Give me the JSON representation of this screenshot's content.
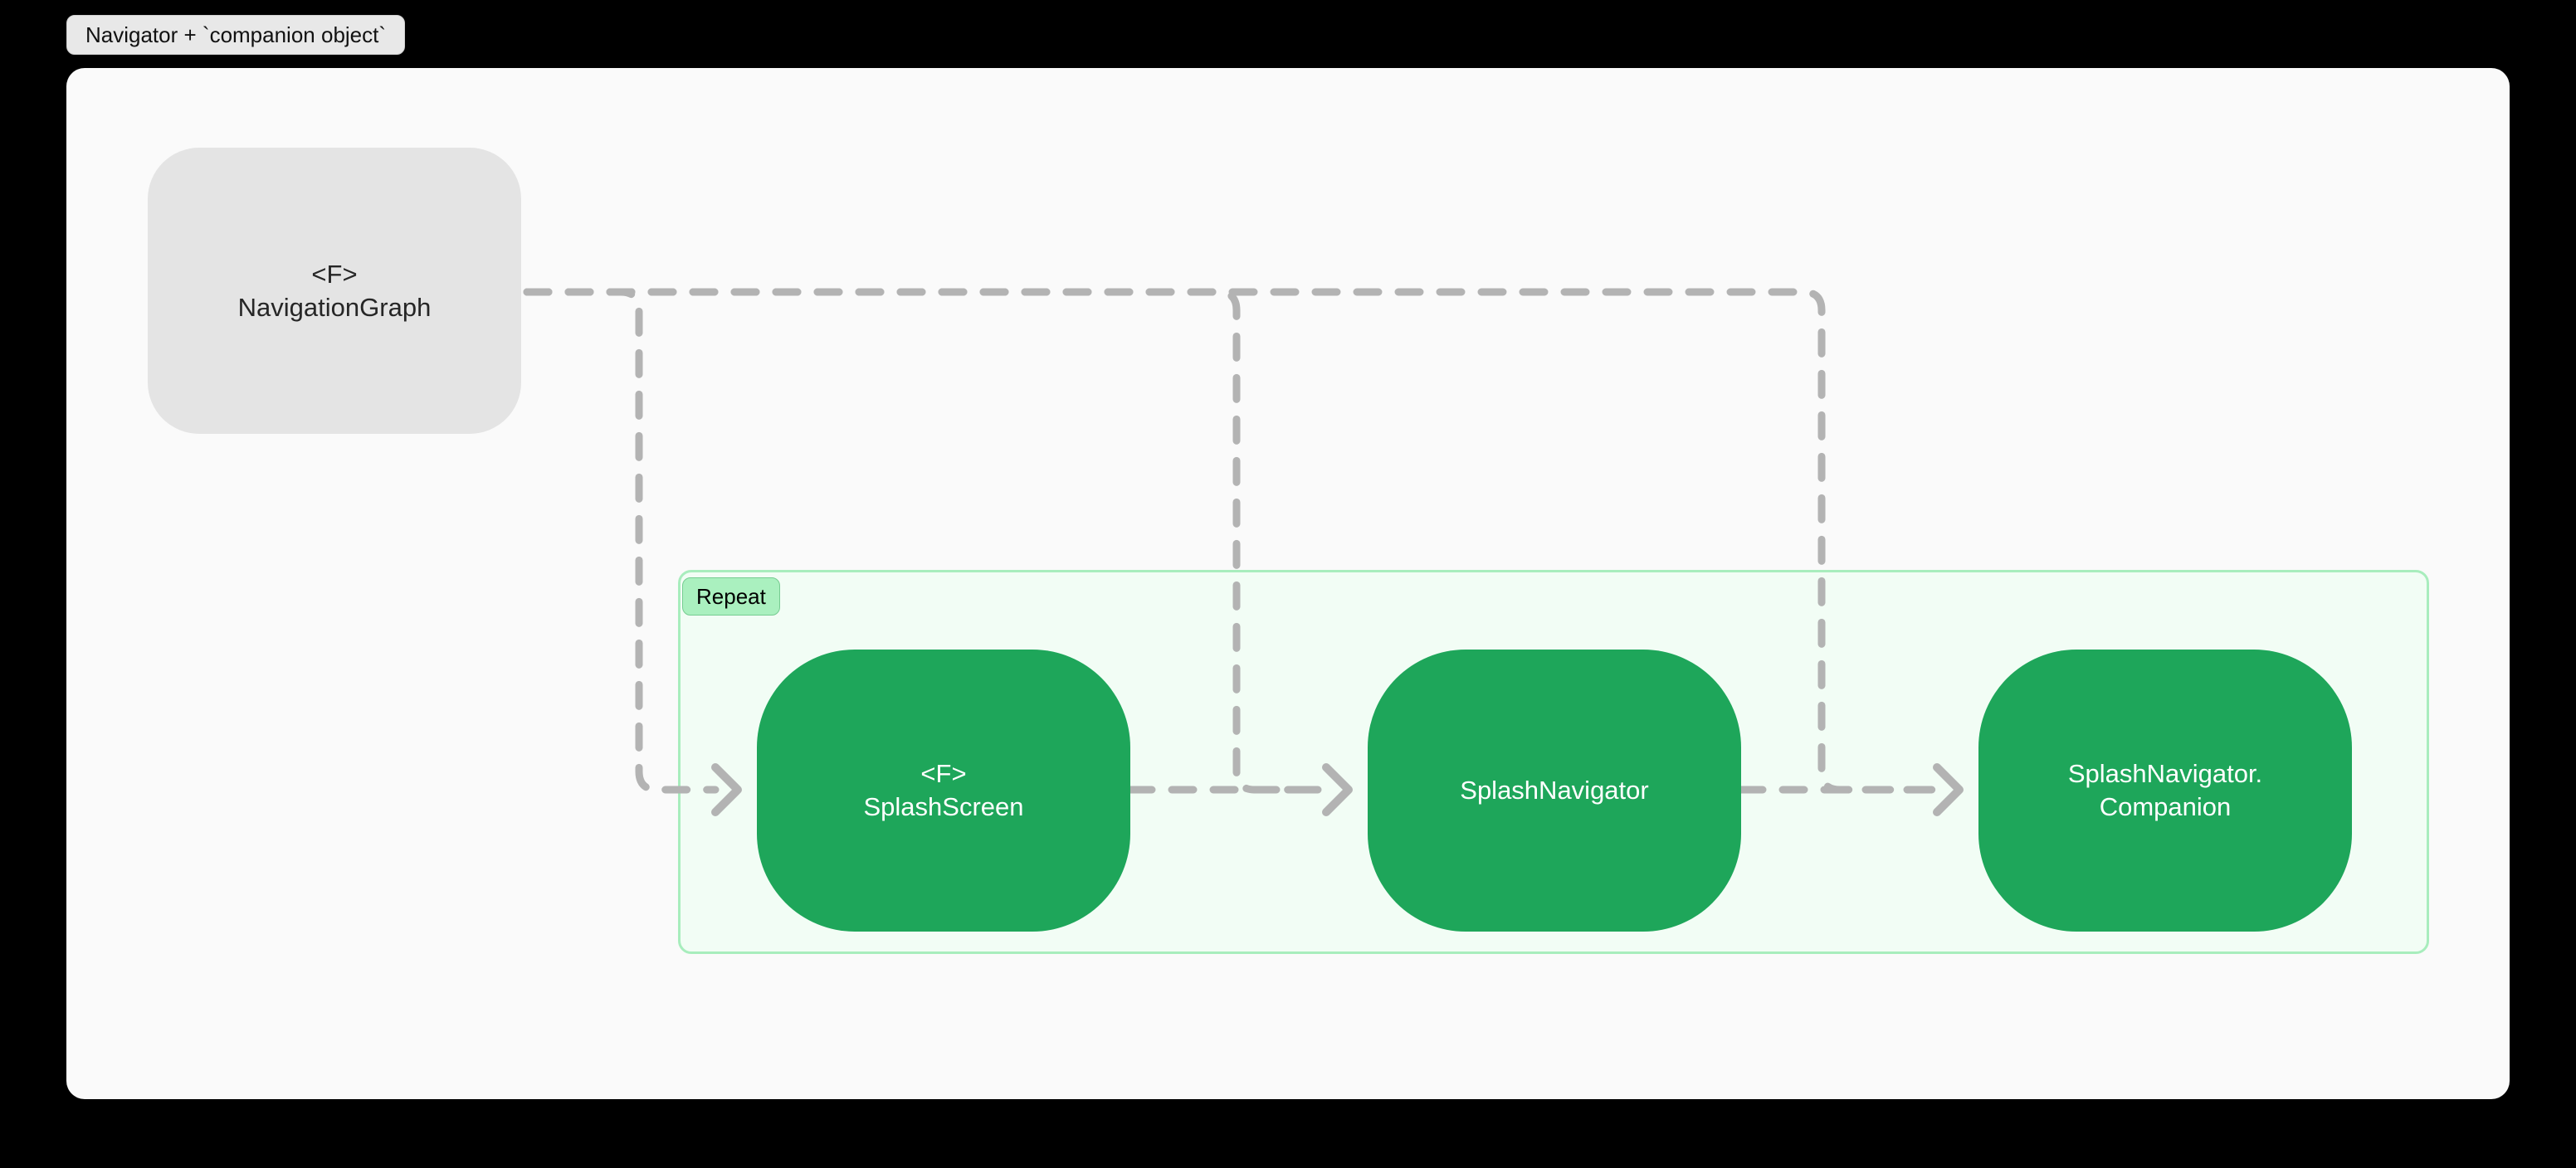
{
  "diagram": {
    "title": "Navigator + `companion object`",
    "colors": {
      "canvas_background": "#fafafa",
      "page_background": "#000000",
      "title_badge_background": "#e8e8e8",
      "gray_node": "#e4e4e4",
      "green_node": "#1ea65a",
      "subgraph_background": "#f2fdf5",
      "subgraph_border": "#a8edbd",
      "subgraph_label_background": "#aaf0bf",
      "edge_stroke": "#b3b3b3",
      "node_label_light": "#ffffff",
      "node_label_dark": "#262626"
    },
    "subgraph": {
      "label": "Repeat"
    },
    "nodes": [
      {
        "id": "navigationgraph",
        "lines": [
          "<F>",
          "NavigationGraph"
        ],
        "style": "gray"
      },
      {
        "id": "splashscreen",
        "lines": [
          "<F>",
          "SplashScreen"
        ],
        "style": "green"
      },
      {
        "id": "splashnavigator",
        "lines": [
          "SplashNavigator"
        ],
        "style": "green"
      },
      {
        "id": "splashnavigatorcompanion",
        "lines": [
          "SplashNavigator.",
          "Companion"
        ],
        "style": "green"
      }
    ],
    "edges": [
      {
        "from": "navigationgraph",
        "to": "splashscreen",
        "style": "dashed",
        "arrow": "open"
      },
      {
        "from": "navigationgraph",
        "to": "splashnavigator",
        "style": "dashed",
        "arrow": "open"
      },
      {
        "from": "navigationgraph",
        "to": "splashnavigatorcompanion",
        "style": "dashed",
        "arrow": "open"
      },
      {
        "from": "splashscreen",
        "to": "splashnavigator",
        "style": "dashed",
        "arrow": "open"
      },
      {
        "from": "splashnavigator",
        "to": "splashnavigatorcompanion",
        "style": "dashed",
        "arrow": "open"
      }
    ]
  }
}
